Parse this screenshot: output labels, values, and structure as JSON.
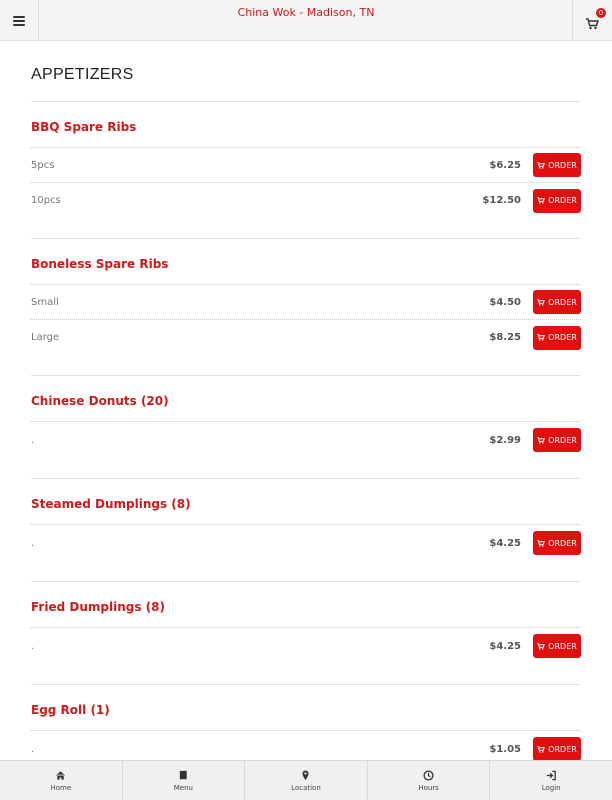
{
  "header": {
    "title": "China Wok - Madison, TN",
    "cart_count": "0"
  },
  "section": {
    "title": "APPETIZERS"
  },
  "order_label": "ORDER",
  "items": [
    {
      "name": "BBQ Spare Ribs",
      "options": [
        {
          "size": "5pcs",
          "price": "$6.25"
        },
        {
          "size": "10pcs",
          "price": "$12.50"
        }
      ]
    },
    {
      "name": "Boneless Spare Ribs",
      "options": [
        {
          "size": "Small",
          "price": "$4.50"
        },
        {
          "size": "Large",
          "price": "$8.25"
        }
      ]
    },
    {
      "name": "Chinese Donuts (20)",
      "options": [
        {
          "size": ".",
          "price": "$2.99"
        }
      ]
    },
    {
      "name": "Steamed Dumplings (8)",
      "options": [
        {
          "size": ".",
          "price": "$4.25"
        }
      ]
    },
    {
      "name": "Fried Dumplings (8)",
      "options": [
        {
          "size": ".",
          "price": "$4.25"
        }
      ]
    },
    {
      "name": "Egg Roll (1)",
      "options": [
        {
          "size": ".",
          "price": "$1.05"
        }
      ]
    }
  ],
  "bottom_nav": [
    {
      "label": "Home",
      "icon": "home-icon"
    },
    {
      "label": "Menu",
      "icon": "book-icon"
    },
    {
      "label": "Location",
      "icon": "map-marker-icon"
    },
    {
      "label": "Hours",
      "icon": "clock-icon"
    },
    {
      "label": "Login",
      "icon": "login-icon"
    }
  ],
  "colors": {
    "accent": "#d11a1a",
    "button": "#e01010"
  }
}
